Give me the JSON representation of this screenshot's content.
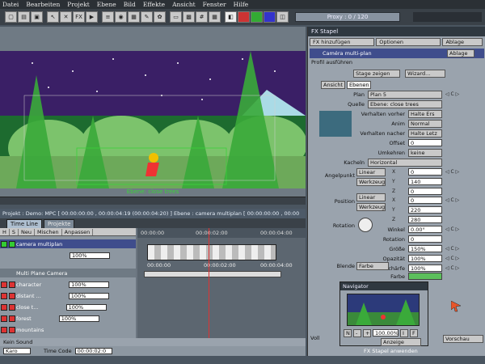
{
  "menu": [
    "Datei",
    "Bearbeiten",
    "Projekt",
    "Ebene",
    "Bild",
    "Effekte",
    "Ansicht",
    "Fenster",
    "Hilfe"
  ],
  "toolbar": {
    "proxy": "Proxy : 0 / 120"
  },
  "viewer": {
    "layer_caption": "Ebene: close trees"
  },
  "project_bar": "Projekt : Demo: MPC [ 00:00:00:00 , 00:00:04:19  (00:00:04:20) ]       Ebene : camera multiplan [ 00:00:00:00 , 00:00",
  "tabs": [
    "Time Line",
    "Projekte"
  ],
  "timeline": {
    "head": [
      "H",
      "S",
      "Neu",
      "Mischen",
      "Anpassen"
    ],
    "ruler": [
      "00:00:00",
      "00:00:02:00",
      "00:00:04:00"
    ],
    "ruler2": [
      "00:00:00",
      "00:00:02:00",
      "00:00:04:00"
    ],
    "layers": [
      {
        "name": "camera multiplan",
        "value": "100%"
      },
      {
        "name": "Multi Plane Camera",
        "value": ""
      },
      {
        "name": "character",
        "value": "100%"
      },
      {
        "name": "distant ...",
        "value": "100%"
      },
      {
        "name": "close t...",
        "value": "100%"
      },
      {
        "name": "forest",
        "value": "100%"
      },
      {
        "name": "mountains",
        "value": "100%"
      }
    ],
    "sound": "Kein Sound",
    "bottom_mode": "Karo",
    "timecode_label": "Time Code",
    "timecode": "00:00:02:0"
  },
  "fx": {
    "title": "FX Stapel",
    "add": "FX hinzufügen",
    "options": "Optionen",
    "storage": "Ablage",
    "effect_name": "Caméra multi-plan",
    "storage2": "Ablage",
    "profile": "Profil ausführen",
    "stage_btn": "Stage zeigen",
    "wizard_btn": "Wizard...",
    "sub_tabs": [
      "Ansicht",
      "Ebenen"
    ],
    "params": [
      {
        "label": "Plan",
        "value": "Plan 5"
      },
      {
        "label": "Quelle",
        "value": "Ebene: close trees"
      },
      {
        "label": "Verhalten vorher",
        "value": "Halte Ers"
      },
      {
        "label": "Anim",
        "value": "Normal"
      },
      {
        "label": "Verhalten nacher",
        "value": "Halte Letz"
      },
      {
        "label": "Offset",
        "value": "0"
      },
      {
        "label": "Umkehren",
        "value": "keine"
      },
      {
        "label": "Kacheln",
        "value": "Horizontal"
      },
      {
        "label": "Angelpunkt",
        "value": "Linear"
      },
      {
        "label": "",
        "value": "Werkzeug"
      },
      {
        "label": "Position",
        "value": "Linear"
      },
      {
        "label": "",
        "value": "Werkzeug"
      },
      {
        "label": "Rotation",
        "value": ""
      },
      {
        "label": "Winkel",
        "value": "0.00°"
      },
      {
        "label": "Rotation",
        "value": "0"
      },
      {
        "label": "Größe",
        "value": "150%"
      },
      {
        "label": "Opazität",
        "value": "100%"
      },
      {
        "label": "Unschärfe",
        "value": "100%"
      },
      {
        "label": "Blende",
        "value": "Farbe"
      },
      {
        "label": "Farbe",
        "value": ""
      }
    ],
    "xyz": [
      {
        "axis": "X",
        "value": "0"
      },
      {
        "axis": "Y",
        "value": "140"
      },
      {
        "axis": "Z",
        "value": "0"
      },
      {
        "axis": "X",
        "value": "0"
      },
      {
        "axis": "Y",
        "value": "220"
      },
      {
        "axis": "Z",
        "value": "280"
      }
    ],
    "full": "Voll",
    "preview": "Vorschau",
    "apply": "FX Stapel anwenden"
  },
  "navigator": {
    "title": "Navigator",
    "zoom": "100.00%",
    "display": "Anzeige",
    "buttons": [
      "N",
      "-",
      "+",
      "I",
      "F"
    ]
  }
}
